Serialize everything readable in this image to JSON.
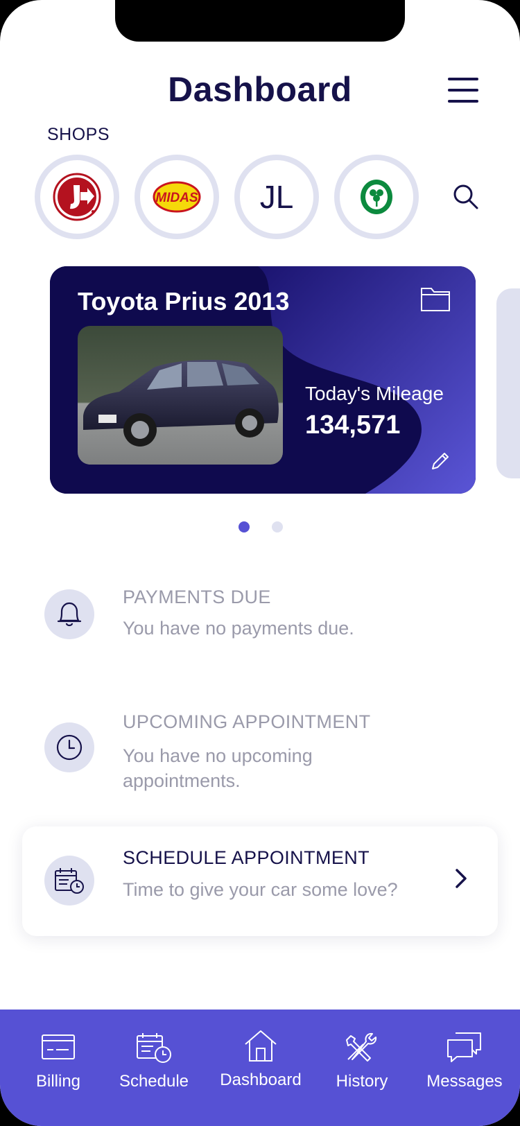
{
  "header": {
    "title": "Dashboard"
  },
  "shops": {
    "label": "SHOPS",
    "items": [
      {
        "name": "Jiffy Lube",
        "logo": "jiffy-lube-logo"
      },
      {
        "name": "Midas",
        "logo": "midas-logo",
        "logo_text": "MIDAS"
      },
      {
        "name": "JL",
        "initials": "JL"
      },
      {
        "name": "Shamrock",
        "logo": "shamrock-logo"
      }
    ]
  },
  "vehicle": {
    "name": "Toyota Prius 2013",
    "mileage_label": "Today's Mileage",
    "mileage_value": "134,571"
  },
  "carousel": {
    "count": 2,
    "active": 0
  },
  "payments": {
    "title": "PAYMENTS DUE",
    "text": "You have no payments due."
  },
  "appointment": {
    "title": "UPCOMING APPOINTMENT",
    "text": "You have no upcoming appointments."
  },
  "schedule": {
    "title": "SCHEDULE APPOINTMENT",
    "text": "Time to give your car some love?"
  },
  "tabs": [
    {
      "label": "Billing",
      "icon": "card-icon"
    },
    {
      "label": "Schedule",
      "icon": "calendar-clock-icon"
    },
    {
      "label": "Dashboard",
      "icon": "home-icon",
      "active": true
    },
    {
      "label": "History",
      "icon": "tools-icon"
    },
    {
      "label": "Messages",
      "icon": "chat-icon"
    }
  ],
  "colors": {
    "navy": "#16124a",
    "accent": "#5651d4",
    "light": "#dfe1f0",
    "muted": "#9a9aaa",
    "card": "#0f0a4e"
  }
}
